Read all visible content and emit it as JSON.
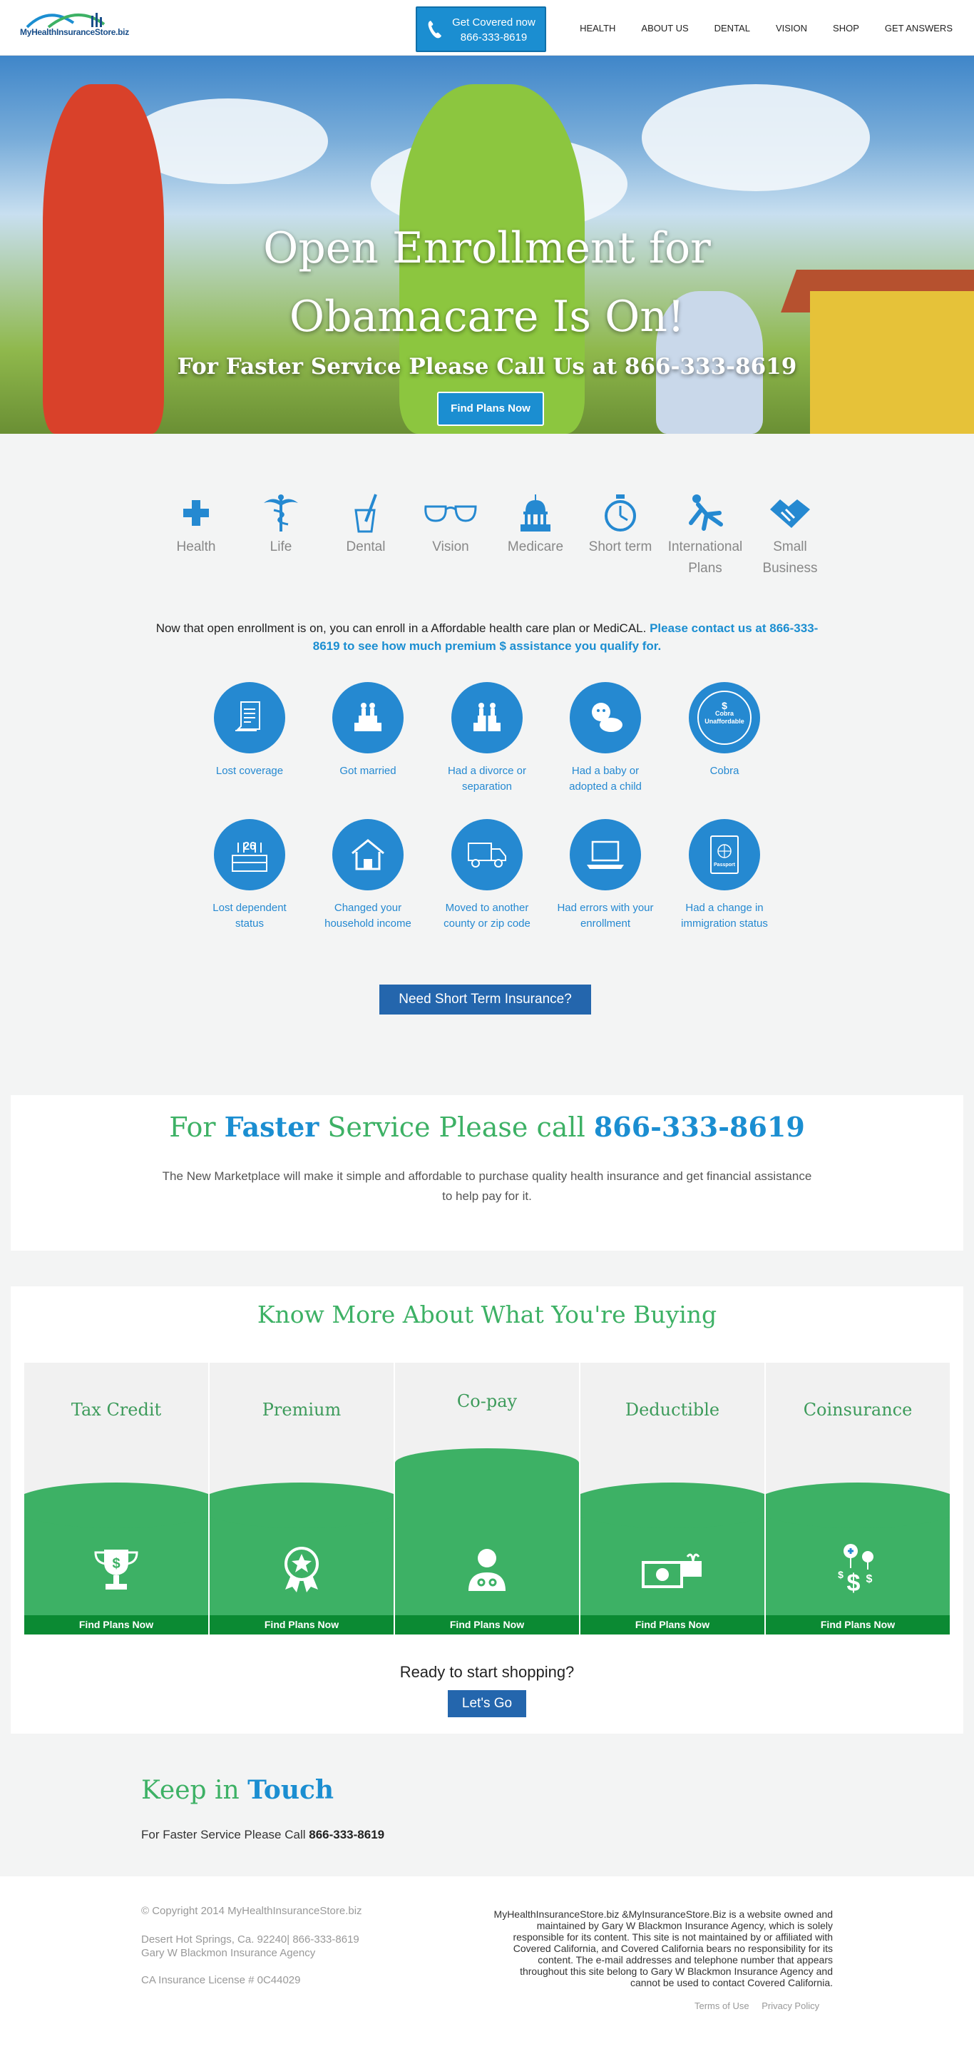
{
  "header": {
    "logo_text": "MyHealthInsuranceStore.biz",
    "cta_line1": "Get Covered now",
    "cta_line2": "866-333-8619",
    "nav": [
      "HEALTH",
      "ABOUT US",
      "DENTAL",
      "VISION",
      "SHOP",
      "GET ANSWERS"
    ]
  },
  "hero": {
    "title_line1": "Open Enrollment for",
    "title_line2": "Obamacare Is On!",
    "subtitle": "For Faster Service Please Call Us at 866-333-8619",
    "button": "Find Plans Now",
    "slides": 2,
    "active_slide": 1
  },
  "categories": [
    {
      "label": "Health",
      "icon": "medical-cross-icon"
    },
    {
      "label": "Life",
      "icon": "caduceus-icon"
    },
    {
      "label": "Dental",
      "icon": "toothbrush-cup-icon"
    },
    {
      "label": "Vision",
      "icon": "glasses-icon"
    },
    {
      "label": "Medicare",
      "icon": "capitol-medicare-icon"
    },
    {
      "label": "Short term",
      "icon": "stopwatch-icon"
    },
    {
      "label": "International Plans",
      "icon": "falling-person-icon"
    },
    {
      "label": "Small Business",
      "icon": "handshake-icon"
    }
  ],
  "intro": {
    "text": "Now that open enrollment is on, you can enroll in a Affordable health care plan or MediCAL.",
    "highlight": "Please contact us at 866-333-8619 to see how much premium $ assistance you qualify for."
  },
  "events": [
    {
      "label": "Lost coverage",
      "icon": "document-icon"
    },
    {
      "label": "Got married",
      "icon": "wedding-cake-icon"
    },
    {
      "label": "Had a divorce or separation",
      "icon": "divided-cake-icon"
    },
    {
      "label": "Had a baby or adopted a child",
      "icon": "baby-icon"
    },
    {
      "label": "Cobra",
      "icon": "cobra-unaffordable-icon"
    },
    {
      "label": "Lost dependent status",
      "icon": "birthday-cake-26-icon"
    },
    {
      "label": "Changed your household income",
      "icon": "house-icon"
    },
    {
      "label": "Moved to another county or zip code",
      "icon": "moving-truck-icon"
    },
    {
      "label": "Had errors with your enrollment",
      "icon": "laptop-icon"
    },
    {
      "label": "Had a change in immigration status",
      "icon": "passport-icon"
    }
  ],
  "cobra_badge": {
    "line1": "$",
    "line2": "Cobra",
    "line3": "Unaffordable"
  },
  "cake_number": "26",
  "passport_text": "Passport",
  "short_term_button": "Need Short Term Insurance?",
  "faster": {
    "prefix": "For ",
    "bold": "Faster",
    "middle": " Service Please call ",
    "phone": "866-333-8619",
    "body": "The New Marketplace will make it simple and affordable to purchase quality health insurance and get financial assistance to help pay for it."
  },
  "know_more": {
    "title": "Know More About What You're Buying",
    "cards": [
      {
        "title": "Tax Credit",
        "icon": "trophy-dollar-icon",
        "button": "Find Plans Now"
      },
      {
        "title": "Premium",
        "icon": "award-star-icon",
        "button": "Find Plans Now"
      },
      {
        "title": "Co-pay",
        "icon": "doctor-icon",
        "button": "Find Plans Now"
      },
      {
        "title": "Deductible",
        "icon": "money-gift-icon",
        "button": "Find Plans Now"
      },
      {
        "title": "Coinsurance",
        "icon": "dollar-balloons-icon",
        "button": "Find Plans Now"
      }
    ],
    "ready": "Ready to start shopping?",
    "go_button": "Let's Go"
  },
  "keep_in_touch": {
    "title_green": "Keep in ",
    "title_blue": "Touch",
    "line_prefix": "For Faster Service Please Call ",
    "phone": "866-333-8619"
  },
  "footer": {
    "copyright": "© Copyright 2014 MyHealthInsuranceStore.biz",
    "address": "Desert Hot Springs, Ca. 92240| 866-333-8619",
    "agency": "Gary W Blackmon Insurance Agency",
    "license": "CA Insurance License # 0C44029",
    "disclaimer": "MyHealthInsuranceStore.biz &MyInsuranceStore.Biz is a website owned and maintained by Gary W Blackmon Insurance Agency, which is solely responsible for its content. This site is not maintained by or affiliated with Covered California, and Covered California bears no responsibility for its content. The e-mail addresses and telephone number that appears throughout this site belong to Gary W Blackmon Insurance Agency and cannot be used to contact Covered California.",
    "links": [
      "Terms of Use",
      "Privacy Policy"
    ]
  },
  "colors": {
    "blue": "#1b8ed1",
    "green": "#3db165",
    "dark_green": "#0b8a33",
    "navy_button": "#2466ad"
  }
}
